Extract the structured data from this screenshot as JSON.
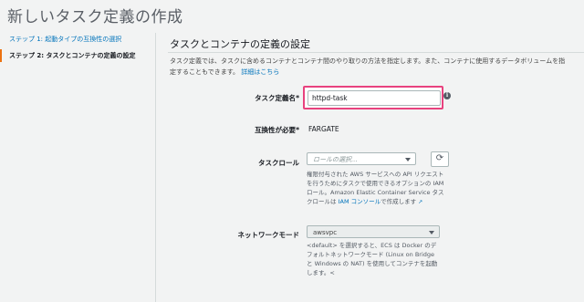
{
  "page": {
    "title": "新しいタスク定義の作成"
  },
  "sidebar": {
    "steps": [
      {
        "label": "ステップ 1: 起動タイプの互換性の選択"
      },
      {
        "label": "ステップ 2: タスクとコンテナの定義の設定"
      }
    ]
  },
  "main": {
    "section_title": "タスクとコンテナの定義の設定",
    "description": "タスク定義では、タスクに含めるコンテナとコンテナ間のやり取りの方法を指定します。また、コンテナに使用するデータボリュームを指定することもできます。",
    "description_link": "詳細はこちら"
  },
  "form": {
    "task_name": {
      "label": "タスク定義名",
      "required_mark": "*",
      "value": "httpd-task",
      "info_icon": "info-icon"
    },
    "compatibility": {
      "label": "互換性が必要",
      "required_mark": "*",
      "value": "FARGATE"
    },
    "task_role": {
      "label": "タスクロール",
      "placeholder": "ロールの選択...",
      "refresh_icon": "refresh-icon",
      "help_text": "権限付与された AWS サービスへの API リクエストを行うためにタスクで使用できるオプションの IAM ロール。Amazon Elastic Container Service タスクロールは",
      "help_link": "IAM コンソール",
      "help_suffix": "で作成します"
    },
    "network_mode": {
      "label": "ネットワークモード",
      "value": "awsvpc",
      "help_text": "<default> を選択すると、ECS は Docker のデフォルトネットワークモード (Linux on Bridge と Windows の NAT) を使用してコンテナを起動します。<"
    }
  }
}
